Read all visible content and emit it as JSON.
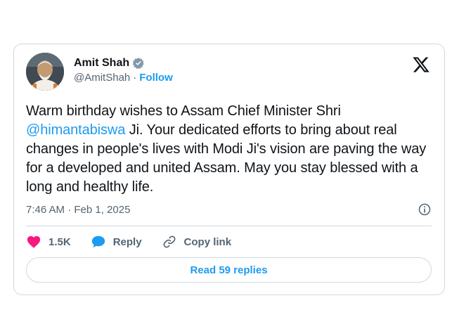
{
  "author": {
    "name": "Amit Shah",
    "handle": "@AmitShah",
    "separator": "·",
    "follow_label": "Follow"
  },
  "tweet": {
    "text_before_mention": "Warm birthday wishes to Assam Chief Minister Shri ",
    "mention": "@himantabiswa",
    "text_after_mention": " Ji. Your dedicated efforts to bring about real changes in people's lives with Modi Ji's vision are paving the way for a developed and united Assam. May you stay blessed with a long and healthy life.",
    "timestamp": "7:46 AM · Feb 1, 2025"
  },
  "actions": {
    "like_count": "1.5K",
    "reply_label": "Reply",
    "copy_link_label": "Copy link"
  },
  "read_replies_label": "Read 59 replies",
  "colors": {
    "accent": "#1d9bf0",
    "like": "#f91880",
    "text": "#0f1419",
    "secondary": "#536471",
    "border": "#cfd9de"
  },
  "icons": {
    "verified": "verified-badge-icon",
    "logo": "x-logo-icon",
    "info": "info-icon",
    "like": "heart-icon",
    "reply": "speech-bubble-icon",
    "copy": "link-icon"
  }
}
